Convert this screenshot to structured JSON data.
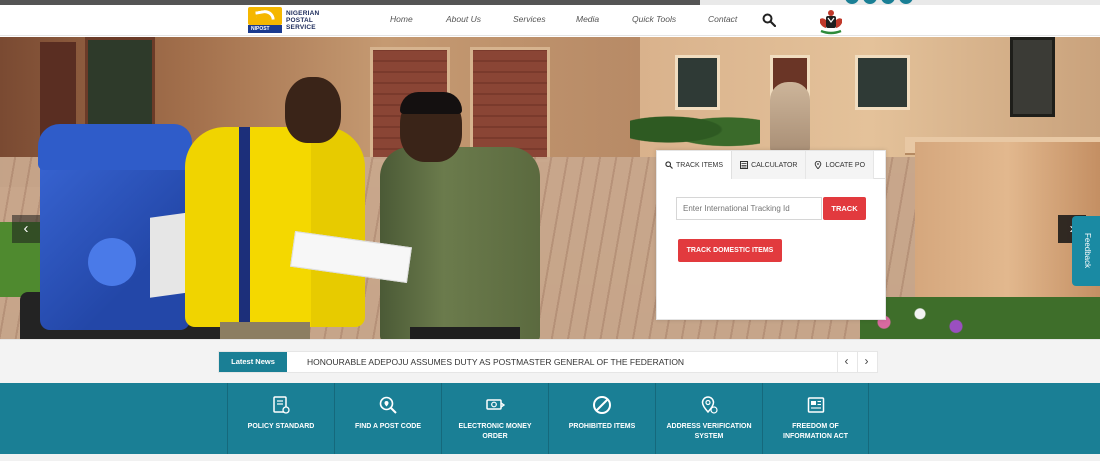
{
  "brand": {
    "logo_mark_text": "NIPOST",
    "name_line1": "NIGERIAN",
    "name_line2": "POSTAL",
    "name_line3": "SERVICE"
  },
  "nav": {
    "items": [
      {
        "label": "Home"
      },
      {
        "label": "About Us"
      },
      {
        "label": "Services"
      },
      {
        "label": "Media"
      },
      {
        "label": "Quick Tools"
      },
      {
        "label": "Contact"
      }
    ],
    "search_icon": "search-icon",
    "coat_of_arms_icon": "coat-of-arms-icon"
  },
  "hero": {
    "prev_arrow": "‹",
    "next_arrow": "›",
    "slides_count": 4,
    "active_slide": 2
  },
  "tracking": {
    "tabs": [
      {
        "label": "TRACK ITEMS",
        "icon": "search-icon",
        "active": true
      },
      {
        "label": "CALCULATOR",
        "icon": "calculator-icon",
        "active": false
      },
      {
        "label": "LOCATE PO",
        "icon": "location-pin-icon",
        "active": false
      }
    ],
    "input_placeholder": "Enter International Tracking Id",
    "input_value": "",
    "track_button": "TRACK",
    "domestic_button": "TRACK DOMESTIC ITEMS"
  },
  "feedback": {
    "label": "Feedback"
  },
  "news": {
    "label": "Latest News",
    "headline": "HONOURABLE ADEPOJU ASSUMES DUTY AS POSTMASTER GENERAL OF THE FEDERATION",
    "prev": "‹",
    "next": "›"
  },
  "services": [
    {
      "label": "POLICY STANDARD",
      "icon": "policy-document-icon"
    },
    {
      "label": "FIND A POST CODE",
      "icon": "location-search-icon"
    },
    {
      "label": "ELECTRONIC MONEY ORDER",
      "icon": "money-icon"
    },
    {
      "label": "PROHIBITED ITEMS",
      "icon": "prohibited-icon"
    },
    {
      "label": "ADDRESS VERIFICATION SYSTEM",
      "icon": "address-verification-icon"
    },
    {
      "label": "FREEDOM OF INFORMATION ACT",
      "icon": "newspaper-icon"
    }
  ],
  "colors": {
    "teal": "#1a7f95",
    "red": "#e23a3e",
    "brand_yellow": "#f5b700",
    "brand_blue": "#1b3b8f"
  }
}
